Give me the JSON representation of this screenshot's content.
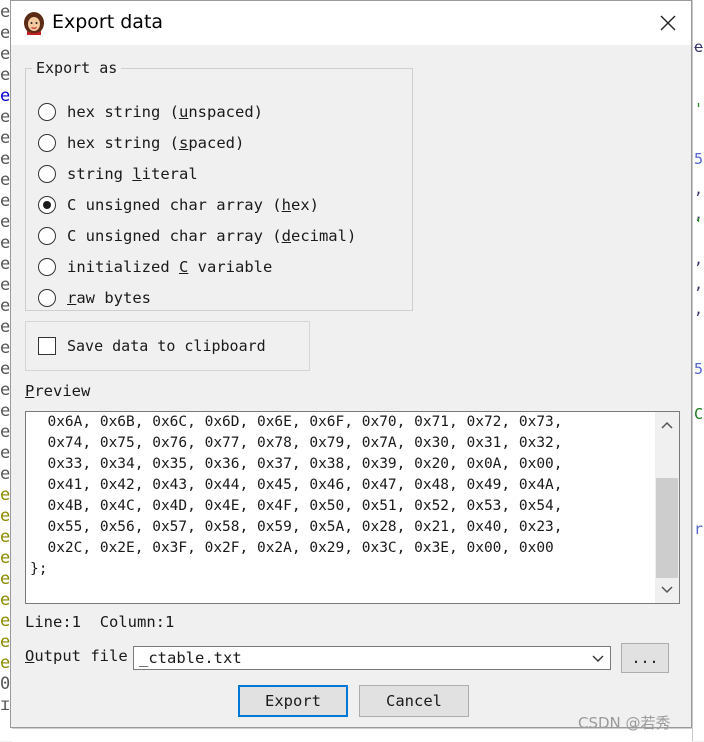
{
  "window": {
    "title": "Export data",
    "close_icon": "close-icon"
  },
  "export_as": {
    "legend": "Export as",
    "options": [
      {
        "pre": "hex string (",
        "key": "u",
        "post": "nspaced)",
        "selected": false
      },
      {
        "pre": "hex string (",
        "key": "s",
        "post": "paced)",
        "selected": false
      },
      {
        "pre": "string ",
        "key": "l",
        "post": "iteral",
        "selected": false
      },
      {
        "pre": "C unsigned char array (",
        "key": "h",
        "post": "ex)",
        "selected": true
      },
      {
        "pre": "C unsigned char array (",
        "key": "d",
        "post": "ecimal)",
        "selected": false
      },
      {
        "pre": "initialized ",
        "key": "C",
        "post": " variable",
        "selected": false
      },
      {
        "pre": "",
        "key": "r",
        "post": "aw bytes",
        "selected": false
      }
    ]
  },
  "clipboard": {
    "label": "Save data to clipboard",
    "checked": false
  },
  "preview": {
    "label_key": "P",
    "label_rest": "review",
    "lines": [
      "  0x6A, 0x6B, 0x6C, 0x6D, 0x6E, 0x6F, 0x70, 0x71, 0x72, 0x73,",
      "  0x74, 0x75, 0x76, 0x77, 0x78, 0x79, 0x7A, 0x30, 0x31, 0x32,",
      "  0x33, 0x34, 0x35, 0x36, 0x37, 0x38, 0x39, 0x20, 0x0A, 0x00,",
      "  0x41, 0x42, 0x43, 0x44, 0x45, 0x46, 0x47, 0x48, 0x49, 0x4A,",
      "  0x4B, 0x4C, 0x4D, 0x4E, 0x4F, 0x50, 0x51, 0x52, 0x53, 0x54,",
      "  0x55, 0x56, 0x57, 0x58, 0x59, 0x5A, 0x28, 0x21, 0x40, 0x23,",
      "  0x2C, 0x2E, 0x3F, 0x2F, 0x2A, 0x29, 0x3C, 0x3E, 0x00, 0x00",
      "};"
    ]
  },
  "status": {
    "line_label": "Line:",
    "line": "1",
    "column_label": "Column:",
    "column": "1"
  },
  "output": {
    "label_key": "O",
    "label_rest": "utput file",
    "value": "_ctable.txt",
    "browse_label": "..."
  },
  "buttons": {
    "export": "Export",
    "cancel": "Cancel"
  },
  "watermark": "CSDN @若秀",
  "background": {
    "left_chars": [
      "e",
      "e",
      "e",
      "e",
      "e",
      "e",
      "e",
      "e",
      "e",
      "e",
      "e",
      "e",
      "e",
      "e",
      "e",
      "e",
      "e",
      "e",
      "e",
      "e",
      "e",
      "e",
      "e",
      "e",
      "e",
      "e",
      "e",
      "e",
      "e",
      "e",
      "e",
      "e",
      "0",
      "ɪ"
    ],
    "right_chars": [
      "_",
      "e",
      "'",
      "5",
      ",",
      ",",
      "'",
      ",",
      ",",
      ",",
      "5",
      "C",
      "r"
    ],
    "colors": {
      "accent": "#0078d7",
      "editor_blue": "#0000cc",
      "editor_olive": "#8a8a00"
    }
  }
}
